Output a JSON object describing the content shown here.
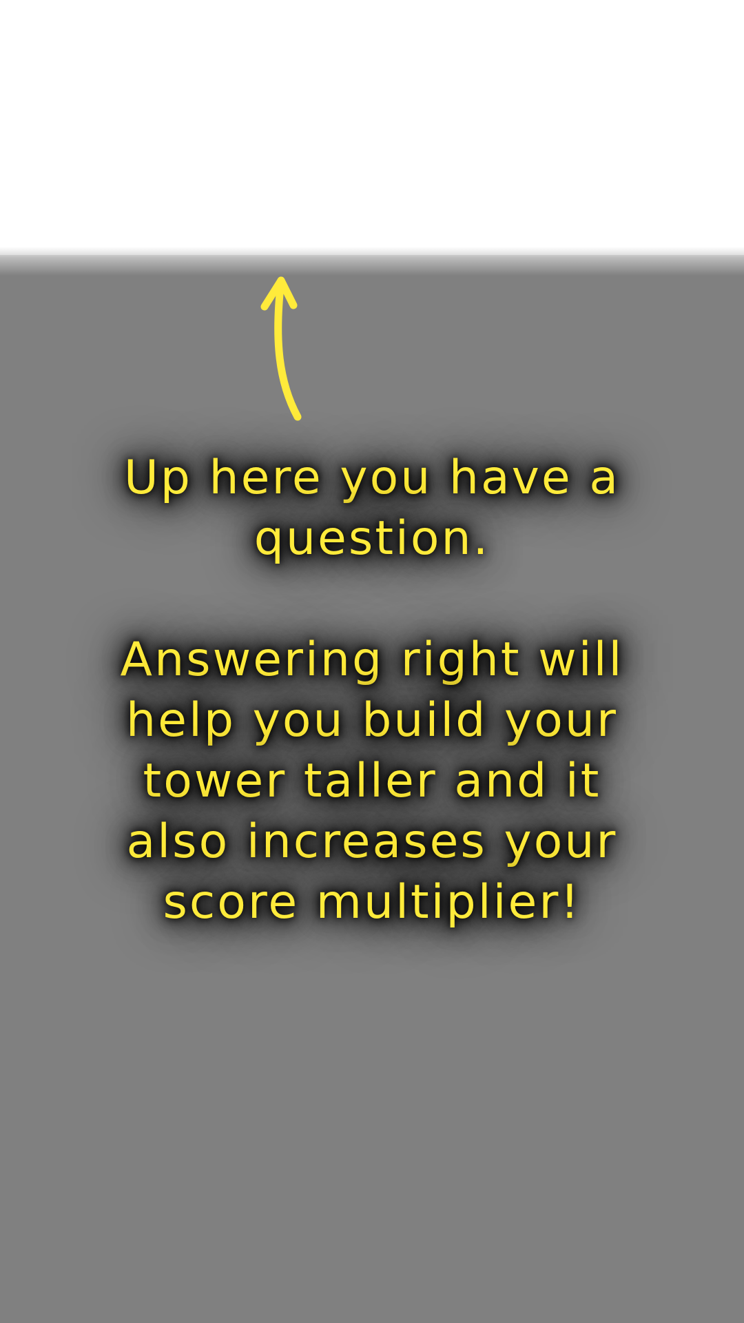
{
  "tutorial": {
    "message": "Up here you have a\nquestion.\n\nAnswering right will\nhelp you build your\ntower taller and it\nalso increases your\nscore multiplier!",
    "pointer_icon": "arrow-up-icon"
  },
  "colors": {
    "accent_text": "#FFEB3B",
    "spotlight": "#FFFFFF",
    "overlay": "#808080"
  }
}
